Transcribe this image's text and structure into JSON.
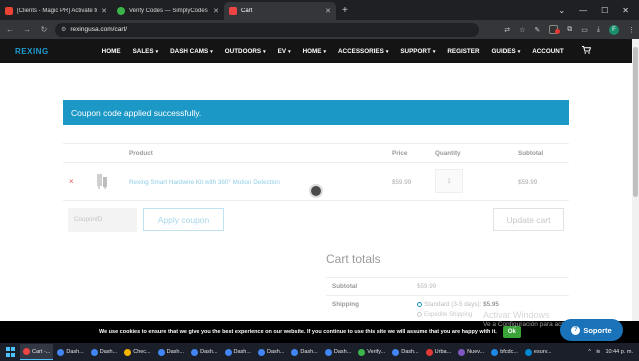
{
  "browser": {
    "tabs": [
      {
        "title": "[Clients - Magic PR] Activate tu",
        "icon": "gmail-icon",
        "color": "#ea4335",
        "active": false
      },
      {
        "title": "Verify Codes — SimplyCodes",
        "icon": "simplycodes-icon",
        "color": "#3bb54a",
        "active": false
      },
      {
        "title": "Cart",
        "icon": "rexing-icon",
        "color": "#ef4444",
        "active": true
      }
    ],
    "new_tab_glyph": "+",
    "url": "rexingusa.com/cart/",
    "profile_initial": "F"
  },
  "site": {
    "logo": "REXING",
    "nav": [
      {
        "label": "HOME",
        "dropdown": false
      },
      {
        "label": "SALES",
        "dropdown": true
      },
      {
        "label": "DASH CAMS",
        "dropdown": true
      },
      {
        "label": "OUTDOORS",
        "dropdown": true
      },
      {
        "label": "EV",
        "dropdown": true
      },
      {
        "label": "HOME",
        "dropdown": true
      },
      {
        "label": "ACCESSORIES",
        "dropdown": true
      },
      {
        "label": "SUPPORT",
        "dropdown": true
      },
      {
        "label": "REGISTER",
        "dropdown": false
      },
      {
        "label": "GUIDES",
        "dropdown": true
      },
      {
        "label": "ACCOUNT",
        "dropdown": false
      }
    ],
    "colors": {
      "brand": "#1d9bd1",
      "notice": "#1c98c6",
      "header": "#141414"
    }
  },
  "notice": "Coupon code applied successfully.",
  "cart": {
    "columns": {
      "product": "Product",
      "price": "Price",
      "quantity": "Quantity",
      "subtotal": "Subtotal"
    },
    "items": [
      {
        "name": "Rexing Smart Hardwire Kit with 360° Motion Detection",
        "price": "$59.99",
        "quantity": "1",
        "subtotal": "$59.99"
      }
    ],
    "remove_glyph": "×",
    "coupon_placeholder": "CouponID",
    "apply_label": "Apply coupon",
    "update_label": "Update cart"
  },
  "totals": {
    "title": "Cart totals",
    "subtotal_label": "Subtotal",
    "subtotal_value": "$59.99",
    "shipping_label": "Shipping",
    "shipping_option": "Standard (3-5 days):",
    "shipping_price": "$5.95",
    "shipping_option_2": "Expedite Shipping"
  },
  "cookie": {
    "text": "We use cookies to ensure that we give you the best experience on our website. If you continue to use this site we will assume that you are happy with it.",
    "ok": "Ok"
  },
  "watermark": {
    "line1": "Activar Windows",
    "line2": "Ve a Configuración para activar"
  },
  "support_button": "Soporte",
  "taskbar": {
    "items": [
      {
        "label": "Cart -...",
        "color": "#ef4444",
        "active": true
      },
      {
        "label": "Dash...",
        "color": "#4285f4",
        "active": false
      },
      {
        "label": "Dash...",
        "color": "#4285f4",
        "active": false
      },
      {
        "label": "Chec...",
        "color": "#f4b400",
        "active": false
      },
      {
        "label": "Dash...",
        "color": "#4285f4",
        "active": false
      },
      {
        "label": "Dash...",
        "color": "#4285f4",
        "active": false
      },
      {
        "label": "Dash...",
        "color": "#4285f4",
        "active": false
      },
      {
        "label": "Dash...",
        "color": "#4285f4",
        "active": false
      },
      {
        "label": "Dash...",
        "color": "#4285f4",
        "active": false
      },
      {
        "label": "Dash...",
        "color": "#4285f4",
        "active": false
      },
      {
        "label": "Verify...",
        "color": "#3bb54a",
        "active": false
      },
      {
        "label": "Dash...",
        "color": "#4285f4",
        "active": false
      },
      {
        "label": "Urba...",
        "color": "#e53935",
        "active": false
      },
      {
        "label": "Nuev...",
        "color": "#7e57c2",
        "active": false
      },
      {
        "label": "bfcdc...",
        "color": "#1e88e5",
        "active": false
      },
      {
        "label": "esurv...",
        "color": "#0288d1",
        "active": false
      }
    ],
    "clock": "10:44 p. m."
  }
}
